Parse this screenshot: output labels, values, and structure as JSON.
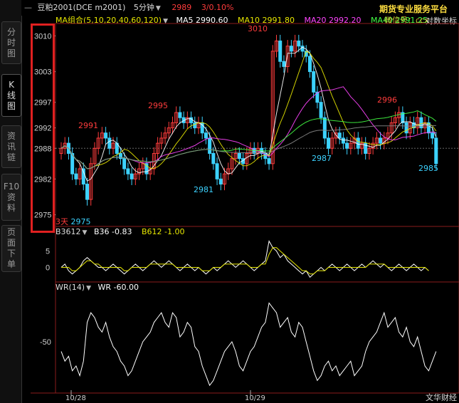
{
  "header": {
    "symbol": "豆粕2001(DCE m2001)",
    "period": "5分钟",
    "price": "2989",
    "change": "3/0.10%"
  },
  "ma_legend": {
    "group": "MA组合(5,10,20,40,60,120)",
    "ma5": "MA5 2990.60",
    "ma10": "MA10 2991.80",
    "ma20": "MA20 2992.20",
    "ma40": "MA40 2991.25"
  },
  "sidebar_tabs": [
    "分时图",
    "K线图",
    "资讯链",
    "F10资料",
    "页面下单"
  ],
  "watermark": {
    "line1": "期货专业服务平台",
    "line2": "微信号：ccx",
    "line3": "对数坐标",
    "footer": "文华财经"
  },
  "indicators": {
    "b36_title": "B3612",
    "b36": "B36 -0.83",
    "b612": "B612 -1.00",
    "wr_title": "WR(14)",
    "wr": "WR -60.00"
  },
  "price_labels": {
    "label_2991": "2991",
    "label_2995": "2995",
    "label_2981": "2981",
    "label_3010": "3010",
    "label_2987": "2987",
    "label_2996": "2996",
    "label_2985": "2985",
    "label_2975": "2975",
    "days_prefix": "3天"
  },
  "x_axis": {
    "d1": "10/28",
    "d2": "10/29"
  },
  "colors": {
    "up": "#ff3c3c",
    "down": "#3cd2ff",
    "ma5": "#ffffff",
    "ma10": "#e6e600",
    "ma20": "#ff44ff",
    "ma40": "#44ff44",
    "ma60": "#888888"
  },
  "chart_data": {
    "type": "candlestick",
    "y_ticks": [
      3010,
      3003,
      2997,
      2992,
      2988,
      2982,
      2975
    ],
    "y_range": [
      2973,
      3012
    ],
    "b36_ticks": [
      5,
      0
    ],
    "b36_range": [
      -4,
      9
    ],
    "wr_ticks": [
      -50
    ],
    "wr_range": [
      -100,
      0
    ],
    "closes": [
      2988,
      2989,
      2987,
      2983,
      2982,
      2984,
      2981,
      2978,
      2985,
      2988,
      2990,
      2991,
      2990,
      2988,
      2989,
      2987,
      2986,
      2984,
      2983,
      2982,
      2983,
      2984,
      2985,
      2983,
      2984,
      2987,
      2989,
      2990,
      2991,
      2992,
      2993,
      2995,
      2994,
      2993,
      2994,
      2993,
      2992,
      2993,
      2991,
      2990,
      2987,
      2985,
      2982,
      2981,
      2983,
      2984,
      2986,
      2987,
      2986,
      2985,
      2987,
      2988,
      2987,
      2988,
      2987,
      2986,
      2985,
      3007,
      3009,
      3005,
      3004,
      3008,
      3007,
      3009,
      3008,
      3007,
      3006,
      3003,
      2999,
      2997,
      2994,
      2990,
      2988,
      2990,
      2991,
      2990,
      2989,
      2988,
      2989,
      2990,
      2988,
      2989,
      2987,
      2988,
      2989,
      2990,
      2989,
      2990,
      2991,
      2993,
      2994,
      2995,
      2993,
      2991,
      2993,
      2992,
      2994,
      2992,
      2993,
      2991,
      2990,
      2985
    ],
    "b36": [
      0,
      1,
      -1,
      -2,
      -1,
      0,
      2,
      3,
      2,
      1,
      0,
      0,
      -1,
      0,
      1,
      0,
      -1,
      -2,
      -1,
      0,
      1,
      0,
      -1,
      0,
      1,
      2,
      1,
      0,
      1,
      2,
      1,
      0,
      -1,
      0,
      1,
      0,
      -1,
      0,
      -1,
      -2,
      -1,
      0,
      -1,
      0,
      1,
      2,
      1,
      0,
      1,
      2,
      1,
      0,
      -1,
      0,
      1,
      2,
      8,
      6,
      5,
      3,
      4,
      2,
      1,
      0,
      -1,
      -2,
      -1,
      -3,
      -2,
      -1,
      0,
      -1,
      0,
      1,
      0,
      -1,
      0,
      1,
      0,
      -1,
      0,
      1,
      0,
      1,
      2,
      1,
      0,
      1,
      0,
      -1,
      0,
      1,
      0,
      -1,
      0,
      1,
      0,
      -1,
      0,
      -1
    ],
    "b612": [
      0,
      0,
      0,
      -1,
      -1,
      0,
      1,
      2,
      2,
      1,
      1,
      0,
      0,
      0,
      0,
      0,
      0,
      -1,
      -1,
      0,
      0,
      0,
      0,
      0,
      1,
      1,
      1,
      1,
      1,
      1,
      1,
      0,
      0,
      0,
      0,
      0,
      0,
      0,
      -1,
      -1,
      -1,
      0,
      0,
      0,
      1,
      1,
      1,
      1,
      1,
      1,
      1,
      0,
      0,
      0,
      1,
      1,
      4,
      6,
      6,
      5,
      4,
      3,
      2,
      1,
      0,
      -1,
      -1,
      -2,
      -2,
      -1,
      -1,
      -1,
      0,
      0,
      0,
      0,
      0,
      0,
      0,
      0,
      0,
      0,
      0,
      1,
      1,
      1,
      1,
      1,
      0,
      0,
      0,
      0,
      0,
      0,
      0,
      0,
      0,
      0,
      0,
      -1
    ],
    "wr": [
      -60,
      -70,
      -65,
      -80,
      -75,
      -85,
      -70,
      -30,
      -20,
      -25,
      -35,
      -40,
      -30,
      -45,
      -55,
      -60,
      -70,
      -75,
      -85,
      -80,
      -70,
      -60,
      -50,
      -45,
      -40,
      -30,
      -25,
      -20,
      -30,
      -35,
      -20,
      -25,
      -45,
      -40,
      -30,
      -35,
      -55,
      -60,
      -75,
      -85,
      -95,
      -90,
      -80,
      -70,
      -60,
      -55,
      -50,
      -60,
      -75,
      -80,
      -70,
      -60,
      -55,
      -45,
      -35,
      -30,
      -10,
      -15,
      -20,
      -35,
      -30,
      -25,
      -40,
      -45,
      -30,
      -35,
      -50,
      -65,
      -80,
      -90,
      -85,
      -75,
      -70,
      -80,
      -75,
      -85,
      -80,
      -75,
      -70,
      -85,
      -80,
      -75,
      -60,
      -50,
      -45,
      -40,
      -30,
      -20,
      -35,
      -30,
      -25,
      -40,
      -45,
      -35,
      -50,
      -55,
      -45,
      -60,
      -75,
      -80,
      -70,
      -60
    ]
  }
}
